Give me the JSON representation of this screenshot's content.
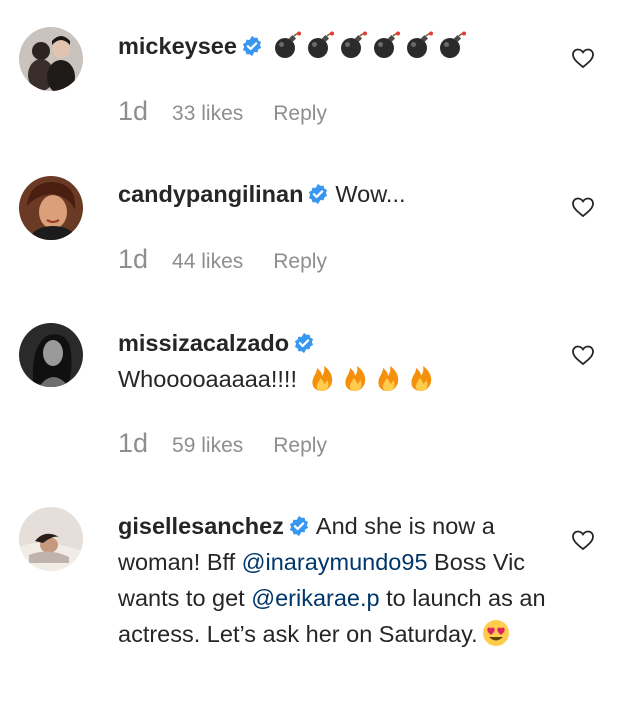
{
  "comments": [
    {
      "username": "mickeysee",
      "text": "",
      "emojis": [
        "bomb",
        "bomb",
        "bomb",
        "bomb",
        "bomb",
        "bomb"
      ],
      "time": "1d",
      "likes": "33 likes",
      "reply": "Reply",
      "avatar_colors": [
        "#b3aba5",
        "#3a2e2a"
      ]
    },
    {
      "username": "candypangilinan",
      "text": "Wow...",
      "time": "1d",
      "likes": "44 likes",
      "reply": "Reply",
      "avatar_colors": [
        "#5a2a1a",
        "#c88a5a"
      ]
    },
    {
      "username": "missizacalzado",
      "text": "Whooooaaaaa!!!!",
      "emojis": [
        "fire",
        "fire",
        "fire",
        "fire"
      ],
      "time": "1d",
      "likes": "59 likes",
      "reply": "Reply",
      "avatar_colors": [
        "#1c1c1c",
        "#7a7a7a"
      ]
    },
    {
      "username": "gisellesanchez",
      "text_part1": "And she is now a woman! Bff",
      "mention1": "@inaraymundo95",
      "text_part2": "Boss Vic wants to get",
      "mention2": "@erikarae.p",
      "text_part3": "to launch as an actress. Let’s ask her on Saturday.",
      "emojis": [
        "heart-eyes"
      ],
      "avatar_colors": [
        "#d8cfc8",
        "#4a3a34"
      ]
    }
  ],
  "colors": {
    "verified": "#3897f0",
    "mention": "#00376b",
    "meta": "#8e8e8e",
    "text": "#262626"
  }
}
